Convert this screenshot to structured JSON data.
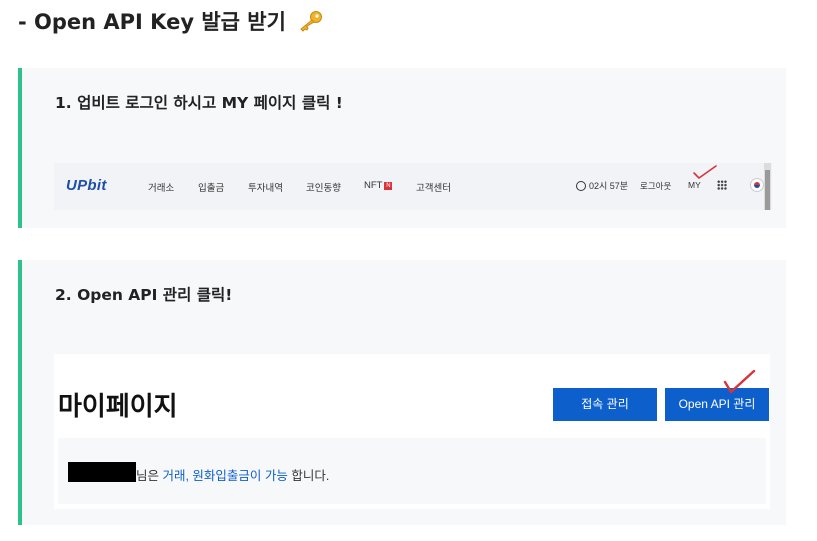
{
  "heading": {
    "text": "- Open API Key 발급 받기",
    "icon": "key-icon"
  },
  "step1": {
    "title": "1. 업비트 로그인 하시고 MY 페이지 클릭 !",
    "upbit": {
      "logo": "UPbit",
      "nav": [
        "거래소",
        "입출금",
        "투자내역",
        "코인동향",
        "NFT",
        "고객센터"
      ],
      "nft_badge": "N",
      "clock": "02시 57분",
      "logout": "로그아웃",
      "my": "MY"
    }
  },
  "step2": {
    "title": "2. Open API 관리 클릭!",
    "mypage": {
      "title": "마이페이지",
      "btn_connection": "접속 관리",
      "btn_api": "Open API 관리",
      "info_suffix": "님은 ",
      "info_link": "거래, 원화입출금이 가능",
      "info_end": " 합니다."
    }
  },
  "colors": {
    "accent_green": "#2ec28b",
    "upbit_blue": "#0d5fcc",
    "check_red": "#d8333a"
  }
}
